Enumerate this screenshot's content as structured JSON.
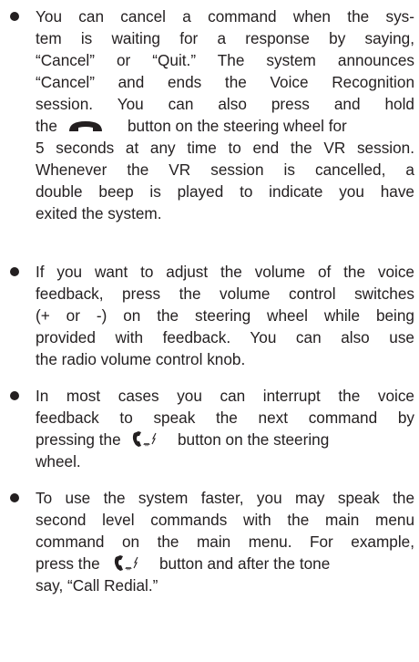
{
  "bullets": [
    {
      "lines": [
        "You can cancel a command when the sys-",
        "tem is waiting for a response by saying,",
        "“Cancel” or “Quit.” The system announces",
        "“Cancel” and ends the Voice Recognition",
        "session. You can also press and hold",
        "the",
        "button on the steering wheel for",
        "5 seconds at any time to end the VR session.",
        "Whenever the VR session is cancelled, a",
        "double beep is played to indicate you have",
        "exited the system."
      ]
    },
    {
      "lines": [
        "If you want to adjust the volume of the voice",
        "feedback, press the volume control switches",
        "(+ or -) on the steering wheel while being",
        "provided with feedback. You can also use",
        "the radio volume control knob."
      ]
    },
    {
      "lines": [
        "In most cases you can interrupt the voice",
        "feedback to speak the next command by",
        "pressing the",
        "button on the steering",
        "wheel."
      ]
    },
    {
      "lines": [
        "To use the system faster, you may speak the",
        "second level commands with the main menu",
        "command on the main menu. For example,",
        "press the",
        "button and after the tone",
        "say, “Call Redial.”"
      ]
    }
  ],
  "icons": {
    "hang_up": "phone-hang-up-icon",
    "talk": "phone-talk-icon"
  },
  "colors": {
    "text": "#231f20",
    "background": "#ffffff"
  }
}
